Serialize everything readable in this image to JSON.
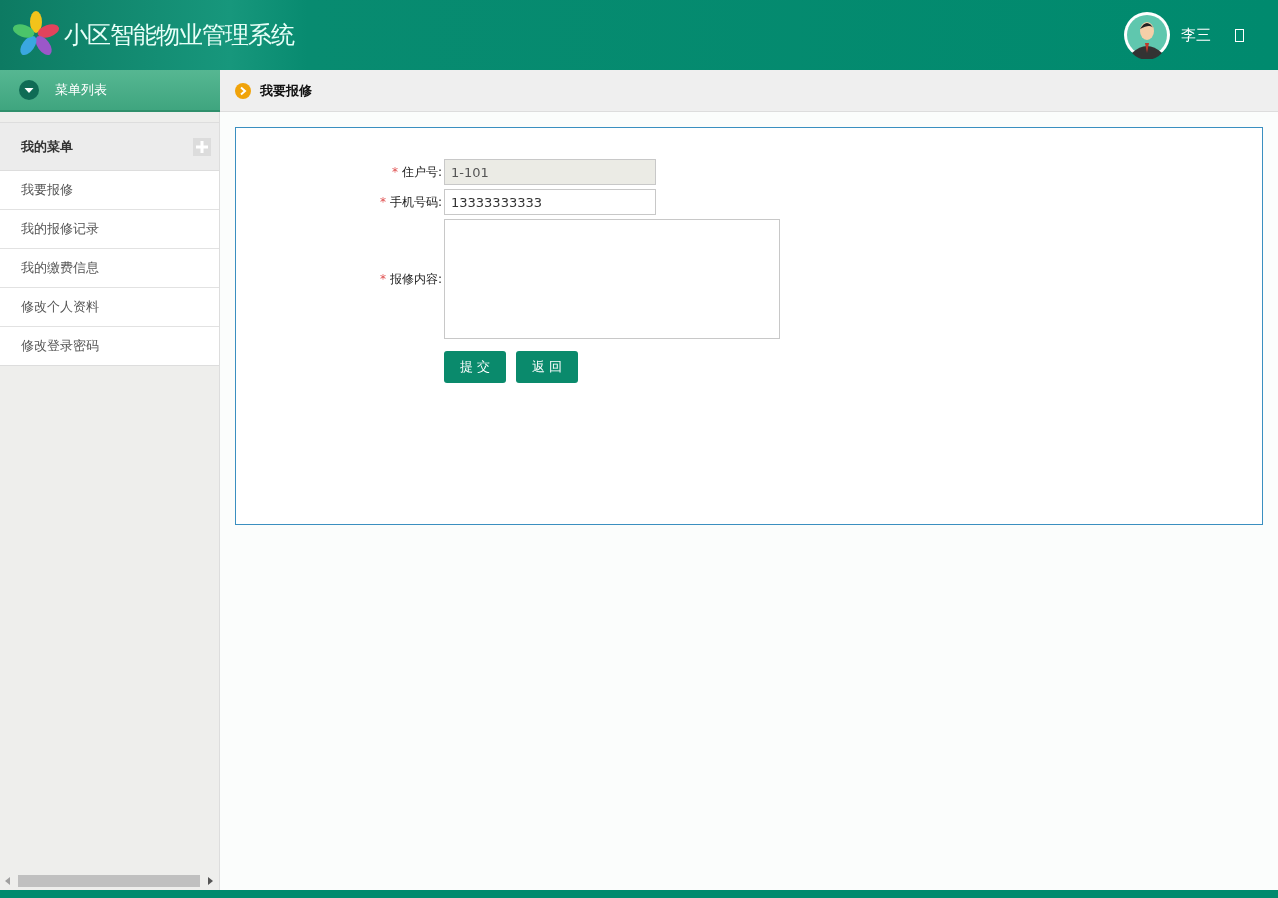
{
  "header": {
    "title": "小区智能物业管理系统",
    "user_name": "李三"
  },
  "sidebar": {
    "heading": "菜单列表",
    "menu_title": "我的菜单",
    "items": [
      {
        "label": "我要报修"
      },
      {
        "label": "我的报修记录"
      },
      {
        "label": "我的缴费信息"
      },
      {
        "label": "修改个人资料"
      },
      {
        "label": "修改登录密码"
      }
    ]
  },
  "page": {
    "title": "我要报修"
  },
  "form": {
    "fields": [
      {
        "kind": "readonly",
        "label": "住户号:",
        "required_mark": "*",
        "value": "1-101"
      },
      {
        "kind": "input",
        "label": "手机号码:",
        "required_mark": "*",
        "value": "13333333333"
      },
      {
        "kind": "textarea",
        "label": "报修内容:",
        "required_mark": "*"
      }
    ],
    "buttons": [
      "提 交",
      "返 回"
    ]
  }
}
